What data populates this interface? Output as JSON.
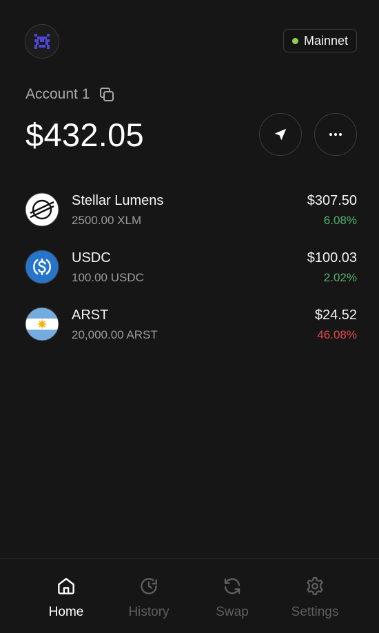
{
  "header": {
    "avatar_icon": "identicon-icon",
    "network_label": "Mainnet",
    "network_status_color": "#8fd14f"
  },
  "account": {
    "name": "Account 1",
    "balance": "$432.05"
  },
  "assets": [
    {
      "name": "Stellar Lumens",
      "amount": "2500.00 XLM",
      "value": "$307.50",
      "change": "6.08%",
      "direction": "up",
      "icon": "stellar-logo-icon"
    },
    {
      "name": "USDC",
      "amount": "100.00 USDC",
      "value": "$100.03",
      "change": "2.02%",
      "direction": "up",
      "icon": "usdc-logo-icon"
    },
    {
      "name": "ARST",
      "amount": "20,000.00 ARST",
      "value": "$24.52",
      "change": "46.08%",
      "direction": "down",
      "icon": "argentina-flag-icon"
    }
  ],
  "nav": {
    "home": "Home",
    "history": "History",
    "swap": "Swap",
    "settings": "Settings"
  },
  "colors": {
    "background": "#161616",
    "positive": "#57b16e",
    "negative": "#e5484d",
    "usdc_blue": "#2775ca",
    "avatar_purple": "#4f46d8"
  }
}
